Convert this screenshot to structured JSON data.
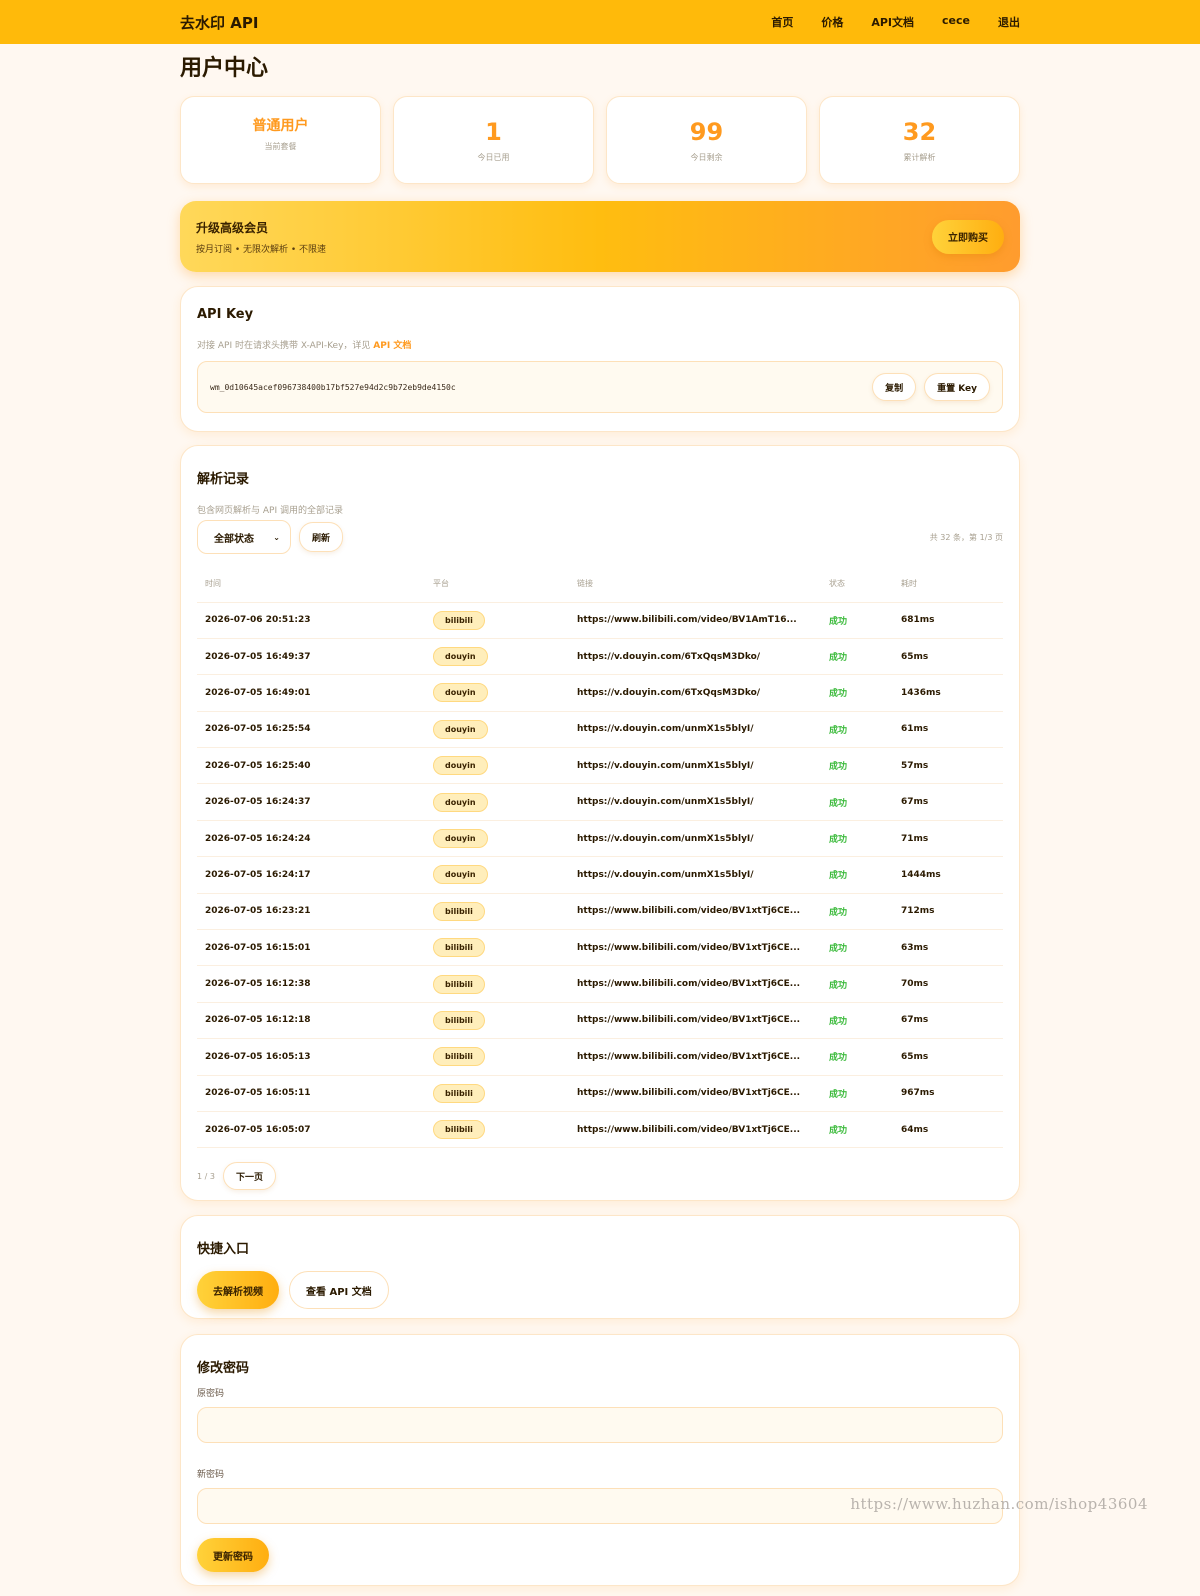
{
  "nav": {
    "brand": "去水印 API",
    "links": [
      "首页",
      "价格",
      "API文档",
      "cece",
      "退出"
    ]
  },
  "page_title": "用户中心",
  "stats": [
    {
      "value": "普通用户",
      "label": "当前套餐"
    },
    {
      "value": "1",
      "label": "今日已用"
    },
    {
      "value": "99",
      "label": "今日剩余"
    },
    {
      "value": "32",
      "label": "累计解析"
    }
  ],
  "upgrade": {
    "title": "升级高级会员",
    "subtitle": "按月订阅 • 无限次解析 • 不限速",
    "button": "立即购买"
  },
  "api_key": {
    "title": "API Key",
    "desc_prefix": "对接 API 时在请求头携带 X-API-Key，详见",
    "desc_link": "API 文档",
    "key": "wm_0d10645acef096738400b17bf527e94d2c9b72eb9de4150c",
    "copy_label": "复制",
    "reset_label": "重置 Key"
  },
  "records": {
    "title": "解析记录",
    "subtitle": "包含网页解析与 API 调用的全部记录",
    "filter_value": "全部状态",
    "refresh_label": "刷新",
    "meta": "共 32 条，第 1/3 页",
    "columns": [
      "时间",
      "平台",
      "链接",
      "状态",
      "耗时"
    ],
    "rows": [
      [
        "2026-07-06 20:51:23",
        "bilibili",
        "https://www.bilibili.com/video/BV1AmT16...",
        "成功",
        "681ms"
      ],
      [
        "2026-07-05 16:49:37",
        "douyin",
        "https://v.douyin.com/6TxQqsM3Dko/",
        "成功",
        "65ms"
      ],
      [
        "2026-07-05 16:49:01",
        "douyin",
        "https://v.douyin.com/6TxQqsM3Dko/",
        "成功",
        "1436ms"
      ],
      [
        "2026-07-05 16:25:54",
        "douyin",
        "https://v.douyin.com/unmX1s5blyI/",
        "成功",
        "61ms"
      ],
      [
        "2026-07-05 16:25:40",
        "douyin",
        "https://v.douyin.com/unmX1s5blyI/",
        "成功",
        "57ms"
      ],
      [
        "2026-07-05 16:24:37",
        "douyin",
        "https://v.douyin.com/unmX1s5blyI/",
        "成功",
        "67ms"
      ],
      [
        "2026-07-05 16:24:24",
        "douyin",
        "https://v.douyin.com/unmX1s5blyI/",
        "成功",
        "71ms"
      ],
      [
        "2026-07-05 16:24:17",
        "douyin",
        "https://v.douyin.com/unmX1s5blyI/",
        "成功",
        "1444ms"
      ],
      [
        "2026-07-05 16:23:21",
        "bilibili",
        "https://www.bilibili.com/video/BV1xtTj6CE...",
        "成功",
        "712ms"
      ],
      [
        "2026-07-05 16:15:01",
        "bilibili",
        "https://www.bilibili.com/video/BV1xtTj6CE...",
        "成功",
        "63ms"
      ],
      [
        "2026-07-05 16:12:38",
        "bilibili",
        "https://www.bilibili.com/video/BV1xtTj6CE...",
        "成功",
        "70ms"
      ],
      [
        "2026-07-05 16:12:18",
        "bilibili",
        "https://www.bilibili.com/video/BV1xtTj6CE...",
        "成功",
        "67ms"
      ],
      [
        "2026-07-05 16:05:13",
        "bilibili",
        "https://www.bilibili.com/video/BV1xtTj6CE...",
        "成功",
        "65ms"
      ],
      [
        "2026-07-05 16:05:11",
        "bilibili",
        "https://www.bilibili.com/video/BV1xtTj6CE...",
        "成功",
        "967ms"
      ],
      [
        "2026-07-05 16:05:07",
        "bilibili",
        "https://www.bilibili.com/video/BV1xtTj6CE...",
        "成功",
        "64ms"
      ]
    ],
    "pager_text": "1 / 3",
    "next_label": "下一页"
  },
  "quick": {
    "title": "快捷入口",
    "parse_label": "去解析视频",
    "docs_label": "查看 API 文档"
  },
  "password": {
    "title": "修改密码",
    "old_label": "原密码",
    "new_label": "新密码",
    "submit_label": "更新密码"
  },
  "watermark": "https://www.huzhan.com/ishop43604",
  "colors": {
    "brand": "#ffba0a",
    "accent": "#ff9a1f",
    "success": "#3dbb3d",
    "background": "#fff8f1"
  }
}
